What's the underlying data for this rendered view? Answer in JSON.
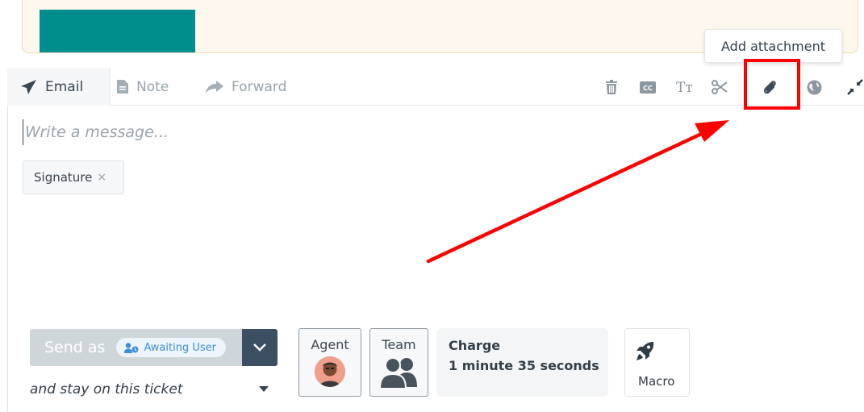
{
  "tooltip": {
    "text": "Add attachment"
  },
  "tabs": [
    {
      "label": "Email",
      "icon": "paper-plane-icon"
    },
    {
      "label": "Note",
      "icon": "note-icon"
    },
    {
      "label": "Forward",
      "icon": "forward-arrow-icon"
    }
  ],
  "toolbar": {
    "icons": [
      "trash-icon",
      "closed-caption-icon",
      "text-size-icon",
      "scissors-icon",
      "paperclip-icon",
      "globe-icon",
      "minimize-icon"
    ],
    "cc_label": "CC",
    "text_label": "Tт"
  },
  "editor": {
    "placeholder": "Write a message..."
  },
  "signature_chip": {
    "label": "Signature",
    "remove": "×"
  },
  "send": {
    "label": "Send as",
    "status": "Awaiting User",
    "stay_option": "and stay on this ticket"
  },
  "assign": {
    "agent_label": "Agent",
    "team_label": "Team"
  },
  "charge": {
    "title": "Charge",
    "value": "1 minute 35 seconds"
  },
  "macro": {
    "label": "Macro"
  },
  "colors": {
    "annotation": "#ff0000",
    "ticket_thumb": "#008d8e",
    "send_dropdown": "#3b4f60",
    "status_text": "#3b8ed8"
  }
}
